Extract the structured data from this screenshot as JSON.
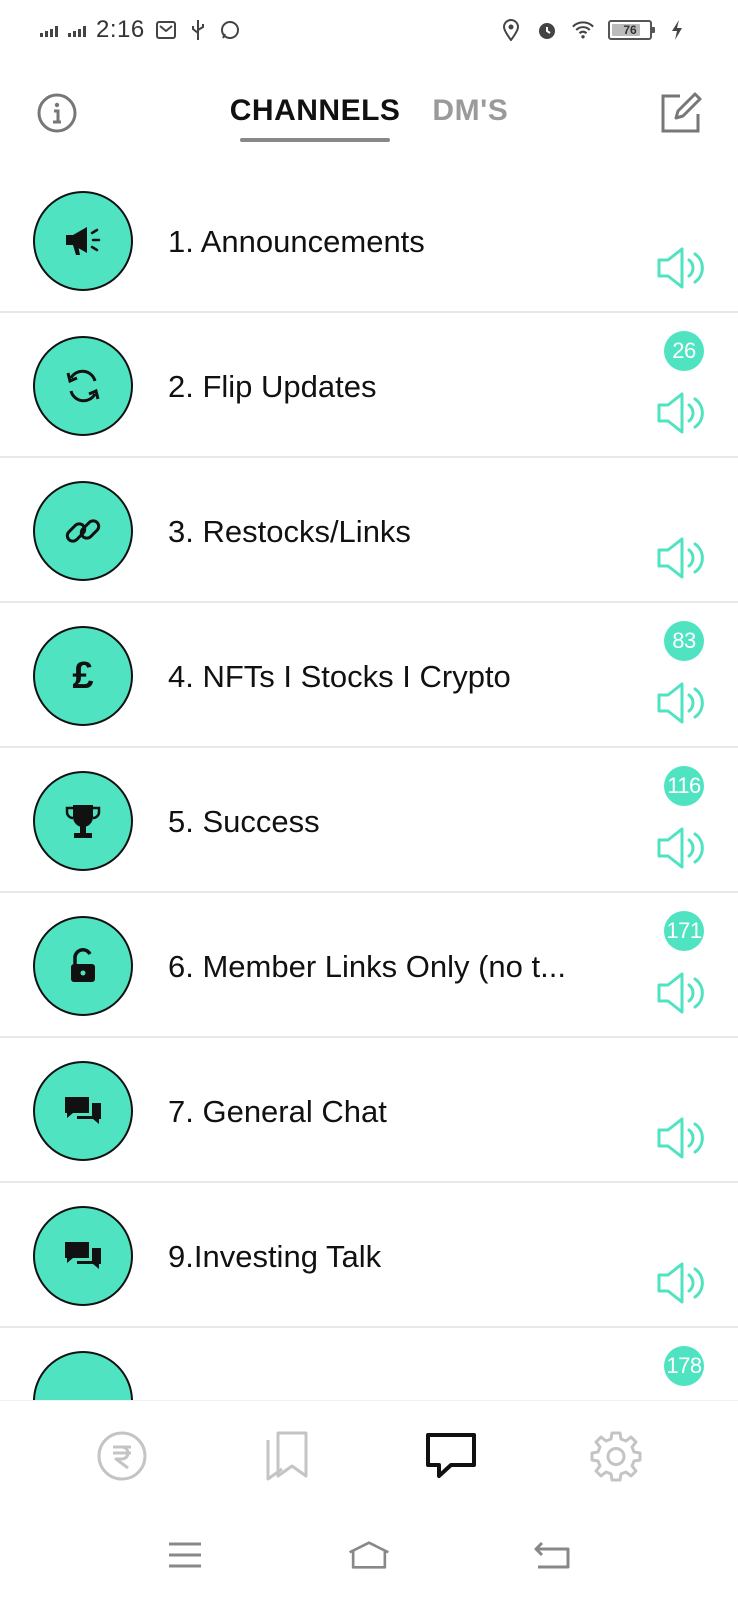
{
  "status_bar": {
    "time": "2:16",
    "battery": "76"
  },
  "header": {
    "tabs": [
      {
        "label": "CHANNELS",
        "active": true
      },
      {
        "label": "DM'S",
        "active": false
      }
    ]
  },
  "colors": {
    "accent": "#4fe3c1",
    "inactive_tab": "#9a9a9a"
  },
  "channels": [
    {
      "name": "1. Announcements",
      "icon": "megaphone-icon",
      "badge": ""
    },
    {
      "name": "2. Flip Updates",
      "icon": "refresh-icon",
      "badge": "26"
    },
    {
      "name": "3. Restocks/Links",
      "icon": "link-icon",
      "badge": ""
    },
    {
      "name": "4. NFTs I Stocks I Crypto",
      "icon": "pound-icon",
      "icon_glyph": "£",
      "badge": "83"
    },
    {
      "name": "5. Success",
      "icon": "trophy-icon",
      "badge": "116"
    },
    {
      "name": "6. Member Links Only (no t...",
      "icon": "lock-icon",
      "badge": "171"
    },
    {
      "name": "7. General Chat",
      "icon": "chat-icon",
      "badge": ""
    },
    {
      "name": "9.Investing Talk",
      "icon": "chat-icon",
      "badge": ""
    },
    {
      "name": "",
      "icon": "",
      "badge": "178"
    }
  ],
  "bottom_nav": [
    {
      "icon": "currency-icon",
      "active": false
    },
    {
      "icon": "bookmarks-icon",
      "active": false
    },
    {
      "icon": "chat-bubble-icon",
      "active": true
    },
    {
      "icon": "gear-icon",
      "active": false
    }
  ]
}
